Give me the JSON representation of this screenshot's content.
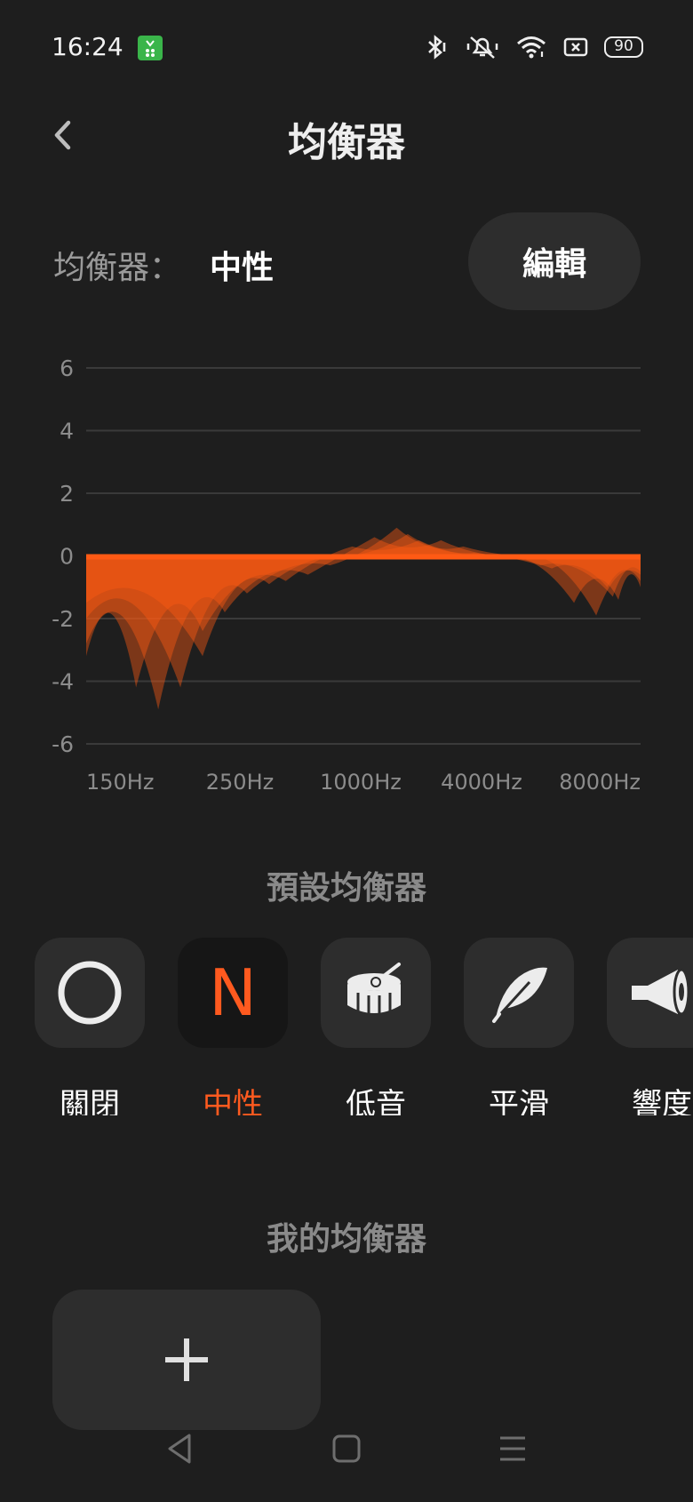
{
  "status_bar": {
    "time": "16:24",
    "battery": "90",
    "icons": [
      "app-notification-icon",
      "bluetooth-icon",
      "silent-icon",
      "wifi-icon",
      "sim-off-icon",
      "battery-icon"
    ]
  },
  "header": {
    "title": "均衡器",
    "back_icon": "back-chevron-icon"
  },
  "current": {
    "label": "均衡器：",
    "value": "中性",
    "edit_label": "編輯"
  },
  "chart_data": {
    "type": "area",
    "y_ticks": [
      "6",
      "4",
      "2",
      "0",
      "-2",
      "-4",
      "-6"
    ],
    "ylim": [
      -6,
      6
    ],
    "x_ticks": [
      "150Hz",
      "250Hz",
      "1000Hz",
      "4000Hz",
      "8000Hz"
    ],
    "grid": true,
    "color": "#ff5a14",
    "series": [
      {
        "peaks": [
          [
            0.0,
            -3.2
          ],
          [
            0.09,
            -4.2
          ],
          [
            0.21,
            -2.4
          ],
          [
            0.36,
            -0.8
          ],
          [
            0.48,
            0.3
          ],
          [
            0.6,
            0.5
          ],
          [
            0.72,
            0.0
          ],
          [
            0.84,
            -0.4
          ],
          [
            0.94,
            -1.0
          ],
          [
            1.0,
            -0.8
          ]
        ]
      },
      {
        "peaks": [
          [
            0.0,
            -2.8
          ],
          [
            0.13,
            -4.9
          ],
          [
            0.25,
            -1.8
          ],
          [
            0.4,
            -0.6
          ],
          [
            0.52,
            0.6
          ],
          [
            0.64,
            0.5
          ],
          [
            0.76,
            0.0
          ],
          [
            0.88,
            -1.5
          ],
          [
            0.96,
            -1.4
          ],
          [
            1.0,
            -1.0
          ]
        ]
      },
      {
        "peaks": [
          [
            0.0,
            -2.0
          ],
          [
            0.17,
            -4.2
          ],
          [
            0.29,
            -1.2
          ],
          [
            0.44,
            -0.3
          ],
          [
            0.56,
            0.9
          ],
          [
            0.68,
            0.3
          ],
          [
            0.8,
            0.0
          ],
          [
            0.92,
            -1.9
          ],
          [
            1.0,
            -0.6
          ]
        ]
      },
      {
        "peaks": [
          [
            0.0,
            -1.5
          ],
          [
            0.21,
            -3.2
          ],
          [
            0.33,
            -0.9
          ],
          [
            0.46,
            0.0
          ],
          [
            0.58,
            0.7
          ],
          [
            0.7,
            0.1
          ],
          [
            0.82,
            -0.3
          ],
          [
            0.95,
            -1.3
          ],
          [
            1.0,
            -0.5
          ]
        ]
      }
    ]
  },
  "presets": {
    "title": "預設均衡器",
    "items": [
      {
        "label": "關閉",
        "icon": "circle-off-icon",
        "selected": false
      },
      {
        "label": "中性",
        "icon": "letter-n-icon",
        "glyph": "N",
        "selected": true
      },
      {
        "label": "低音",
        "icon": "drum-icon",
        "selected": false
      },
      {
        "label": "平滑",
        "icon": "feather-icon",
        "selected": false
      },
      {
        "label": "響度",
        "icon": "megaphone-icon",
        "selected": false
      }
    ]
  },
  "my_eq": {
    "title": "我的均衡器",
    "add_icon": "plus-icon"
  },
  "nav": {
    "icons": [
      "nav-back-icon",
      "nav-home-icon",
      "nav-menu-icon"
    ]
  }
}
